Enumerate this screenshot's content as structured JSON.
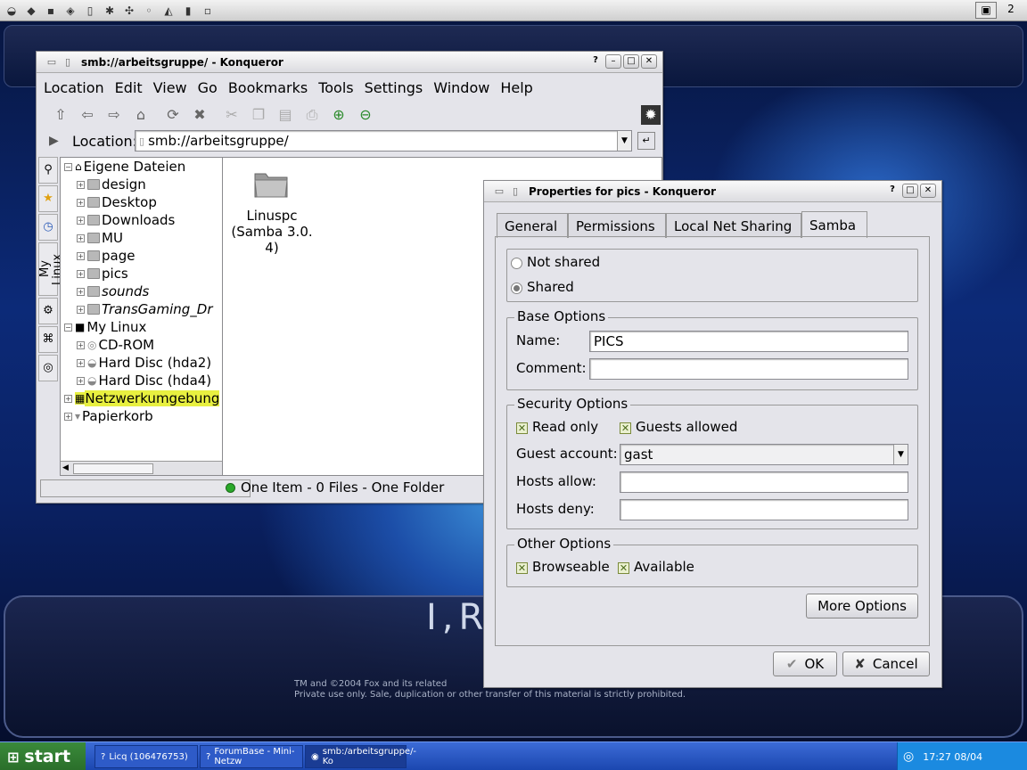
{
  "desktop": {
    "logo_text": "I,R",
    "legal_line1": "TM and ©2004 Fox and its related",
    "legal_line2": "Private use only. Sale, duplication or other transfer of this material is strictly prohibited.",
    "pager_label": "2"
  },
  "taskbar": {
    "start_label": "start",
    "tasks": [
      {
        "label": "Licq (106476753)"
      },
      {
        "label": "ForumBase - Mini-Netzw"
      },
      {
        "label": "smb:/arbeitsgruppe/- Ko"
      }
    ],
    "clock": "17:27 08/04"
  },
  "konqueror": {
    "title": "smb://arbeitsgruppe/ - Konqueror",
    "menu": [
      "Location",
      "Edit",
      "View",
      "Go",
      "Bookmarks",
      "Tools",
      "Settings",
      "Window",
      "Help"
    ],
    "location_label": "Location:",
    "location_value": "smb://arbeitsgruppe/",
    "sidebar_tab_label": "My Linux",
    "tree": [
      {
        "label": "Eigene Dateien"
      },
      {
        "label": "design"
      },
      {
        "label": "Desktop"
      },
      {
        "label": "Downloads"
      },
      {
        "label": "MU"
      },
      {
        "label": "page"
      },
      {
        "label": "pics"
      },
      {
        "label": "sounds"
      },
      {
        "label": "TransGaming_Dr"
      },
      {
        "label": "My Linux"
      },
      {
        "label": "CD-ROM"
      },
      {
        "label": "Hard Disc (hda2)"
      },
      {
        "label": "Hard Disc (hda4)"
      },
      {
        "label": "Netzwerkumgebung"
      },
      {
        "label": "Papierkorb"
      }
    ],
    "file_item_label_1": "Linuspc",
    "file_item_label_2": "(Samba 3.0.",
    "file_item_label_3": "4)",
    "status_text": "One Item - 0 Files - One Folder"
  },
  "properties": {
    "title": "Properties for pics - Konqueror",
    "tabs": [
      "General",
      "Permissions",
      "Local Net Sharing",
      "Samba"
    ],
    "selected_tab": "Samba",
    "not_shared_label": "Not shared",
    "shared_label": "Shared",
    "base_options_title": "Base Options",
    "name_label": "Name:",
    "name_value": "PICS",
    "comment_label": "Comment:",
    "comment_value": "",
    "security_title": "Security Options",
    "read_only_label": "Read only",
    "guests_allowed_label": "Guests allowed",
    "guest_account_label": "Guest account:",
    "guest_account_value": "gast",
    "hosts_allow_label": "Hosts allow:",
    "hosts_allow_value": "",
    "hosts_deny_label": "Hosts deny:",
    "hosts_deny_value": "",
    "other_title": "Other Options",
    "browseable_label": "Browseable",
    "available_label": "Available",
    "more_options_label": "More Options",
    "ok_label": "OK",
    "cancel_label": "Cancel"
  }
}
